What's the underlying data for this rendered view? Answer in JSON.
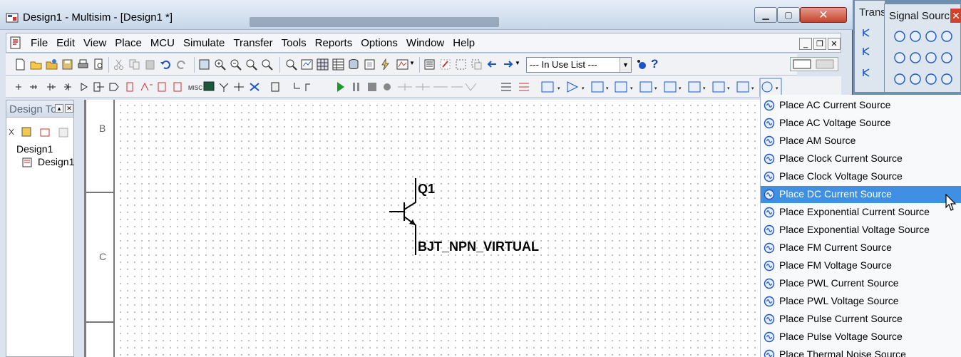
{
  "window": {
    "title": "Design1 - Multisim - [Design1 *]",
    "minimize": "▁",
    "maximize": "▢",
    "close": "✕"
  },
  "menu": {
    "items": [
      "File",
      "Edit",
      "View",
      "Place",
      "MCU",
      "Simulate",
      "Transfer",
      "Tools",
      "Reports",
      "Options",
      "Window",
      "Help"
    ],
    "mdi_min": "_",
    "mdi_restore": "❐",
    "mdi_close": "✕"
  },
  "toolbar": {
    "in_use_list": "--- In Use List ---",
    "help": "?"
  },
  "design_toolbox": {
    "title": "Design To",
    "tree_root": "Design1",
    "tree_child": "Design1"
  },
  "canvas": {
    "row_labels": [
      "B",
      "C"
    ],
    "component_ref": "Q1",
    "component_name": "BJT_NPN_VIRTUAL"
  },
  "signal_source_menu": {
    "items": [
      "Place AC Current Source",
      "Place AC Voltage Source",
      "Place AM Source",
      "Place Clock Current Source",
      "Place Clock Voltage Source",
      "Place DC Current Source",
      "Place Exponential Current Source",
      "Place Exponential Voltage Source",
      "Place FM Current Source",
      "Place FM Voltage Source",
      "Place PWL Current Source",
      "Place PWL Voltage Source",
      "Place Pulse Current Source",
      "Place Pulse Voltage Source",
      "Place Thermal Noise Source"
    ],
    "selected": "Place DC Current Source",
    "selected_color": "#3f8fe3"
  },
  "floating": {
    "trans_title": "Trans",
    "signal_title": "Signal Sourc...",
    "signal_close": "✕"
  }
}
